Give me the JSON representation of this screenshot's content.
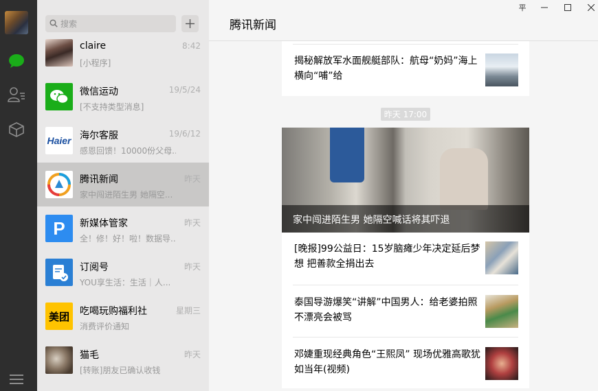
{
  "window": {
    "controls": [
      "pin",
      "minimize",
      "maximize",
      "close"
    ],
    "pin_glyph": "平"
  },
  "sidebar": {
    "icons": [
      "chat-icon",
      "contacts-icon",
      "favorites-icon",
      "menu-icon"
    ],
    "active_color": "#1aad19"
  },
  "search": {
    "placeholder": "搜索"
  },
  "chats": [
    {
      "name": "claire",
      "preview": "[小程序]",
      "time": "8:42"
    },
    {
      "name": "微信运动",
      "preview": "[不支持类型消息]",
      "time": "19/5/24"
    },
    {
      "name": "海尔客服",
      "preview": "感恩回馈！10000份父母...",
      "time": "19/6/12"
    },
    {
      "name": "腾讯新闻",
      "preview": "家中闯进陌生男 她隔空...",
      "time": "昨天"
    },
    {
      "name": "新媒体管家",
      "preview": "全！修！好！啦！数据导...",
      "time": "昨天"
    },
    {
      "name": "订阅号",
      "preview": "YOU享生活：生活｜人...",
      "time": "昨天"
    },
    {
      "name": "吃喝玩购福利社",
      "preview": "消费评价通知",
      "time": "星期三"
    },
    {
      "name": "猫毛",
      "preview": "[转账]朋友已确认收钱",
      "time": "昨天"
    }
  ],
  "avatar_labels": {
    "haier": "Haier",
    "meituan": "美团",
    "xinmeiti": "P"
  },
  "main": {
    "title": "腾讯新闻",
    "top_article": "揭秘解放军水面舰艇部队：航母“奶妈”海上横向“哺”给",
    "time_label": "昨天 17:00",
    "headline": "家中闯进陌生男 她隔空喊话将其吓退",
    "articles": [
      "[晚报]99公益日：15岁脑瘫少年决定延后梦想 把善款全捐出去",
      "泰国导游爆笑“讲解”中国男人：给老婆拍照不漂亮会被骂",
      "邓婕重现经典角色“王熙凤” 现场优雅高歌犹如当年(视频)"
    ]
  }
}
